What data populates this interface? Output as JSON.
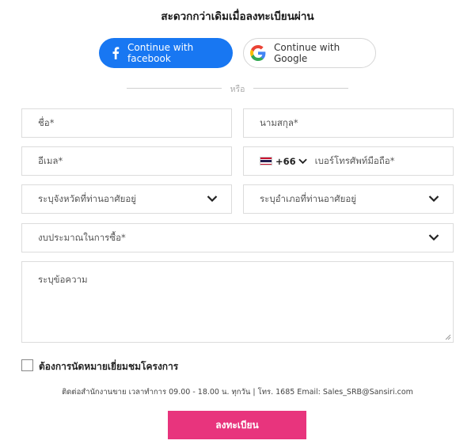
{
  "header": {
    "title": "สะดวกกว่าเดิมเมื่อลงทะเบียนผ่าน"
  },
  "social": {
    "facebook_label": "Continue with facebook",
    "google_label": "Continue with Google",
    "facebook_color": "#1877f2"
  },
  "divider": {
    "or_text": "หรือ"
  },
  "form": {
    "first_name_placeholder": "ชื่อ*",
    "last_name_placeholder": "นามสกุล*",
    "email_placeholder": "อีเมล*",
    "phone_code": "+66",
    "phone_placeholder": "เบอร์โทรศัพท์มือถือ*",
    "province_placeholder": "ระบุจังหวัดที่ท่านอาศัยอยู่",
    "district_placeholder": "ระบุอำเภอที่ท่านอาศัยอยู่",
    "budget_placeholder": "งบประมาณในการซื้อ*",
    "message_placeholder": "ระบุข้อความ",
    "visit_checkbox_label": "ต้องการนัดหมายเยี่ยมชมโครงการ",
    "visit_checkbox_checked": false
  },
  "contact": {
    "text": "ติดต่อสำนักงานขาย เวลาทำการ 09.00 - 18.00 น. ทุกวัน | โทร. 1685 Email: Sales_SRB@Sansiri.com"
  },
  "submit": {
    "label": "ลงทะเบียน",
    "color": "#e8347d"
  },
  "icons": {
    "facebook": "facebook-icon",
    "google": "google-icon",
    "flag": "thailand-flag-icon",
    "chevron": "chevron-down-icon"
  }
}
